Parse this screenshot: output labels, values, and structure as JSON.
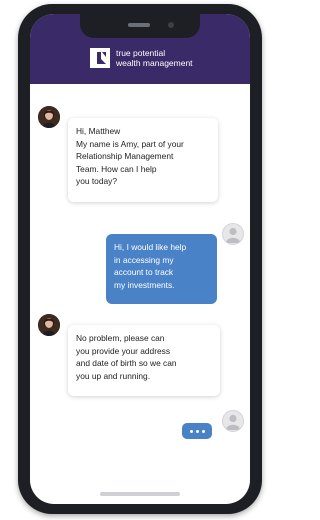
{
  "app": {
    "brand_line1": "true potential",
    "brand_line2": "wealth management"
  },
  "messages": [
    {
      "from": "agent",
      "lines": [
        "Hi, Matthew",
        "My name is Amy, part of your",
        "Relationship Management",
        "Team. How can I help",
        "you today?"
      ]
    },
    {
      "from": "user",
      "lines": [
        "Hi, I would like help",
        "in accessing my",
        "account to track",
        "my investments."
      ]
    },
    {
      "from": "agent",
      "lines": [
        "No problem, please can",
        "you provide your address",
        "and date of birth so we can",
        "you up and running."
      ]
    }
  ],
  "typing_indicator": "•••",
  "colors": {
    "header": "#3b2a68",
    "outgoing_bubble": "#4a82c8",
    "phone_frame": "#1d1f24"
  },
  "icons": {
    "logo": "true-potential-logo-icon",
    "agent_avatar": "agent-avatar-icon",
    "user_avatar": "user-avatar-icon"
  }
}
